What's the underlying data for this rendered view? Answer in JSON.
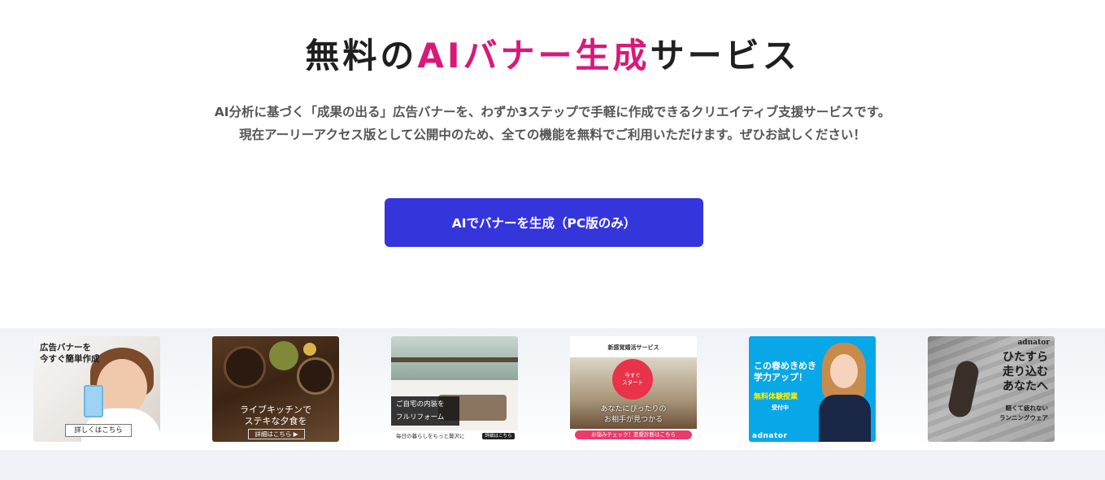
{
  "hero": {
    "title_prefix": "無料の",
    "title_accent": "AIバナー生成",
    "title_suffix": "サービス",
    "description_line1": "AI分析に基づく「成果の出る」広告バナーを、わずか3ステップで手軽に作成できるクリエイティブ支援サービスです。",
    "description_line2": "現在アーリーアクセス版として公開中のため、全ての機能を無料でご利用いただけます。ぜひお試しください！",
    "cta_label": "AIでバナーを生成（PC版のみ）"
  },
  "colors": {
    "accent": "#d8197a",
    "cta_background": "#3535dc"
  },
  "banners": {
    "b1": {
      "line1": "広告バナーを",
      "line2": "今すぐ簡単作成",
      "button": "詳しくはこちら"
    },
    "b2": {
      "line1": "ライブキッチンで",
      "line2": "ステキな夕食を",
      "button": "詳細はこちら ▶"
    },
    "b3": {
      "line1": "ご自宅の内装を",
      "line2": "フルリフォーム",
      "footer": "毎日の暮らしをもっと贅沢に",
      "button": "詳細はこちら"
    },
    "b4": {
      "headline": "新感覚婚活サービス",
      "circle1": "今すぐ",
      "circle2": "スタート",
      "mid1": "あなたにぴったりの",
      "mid2": "お相手が見つかる",
      "pill": "お悩みチェック！恋愛診断はこちら"
    },
    "b5": {
      "line1": "この春めきめき",
      "line2": "学力アップ！",
      "offer": "無料体験授業",
      "sub": "受付中",
      "brand": "adnator"
    },
    "b6": {
      "brand": "adnator",
      "line1": "ひたすら",
      "line2": "走り込む",
      "line3": "あなたへ",
      "sub1": "軽くて疲れない",
      "sub2": "ランニングウェア"
    }
  }
}
